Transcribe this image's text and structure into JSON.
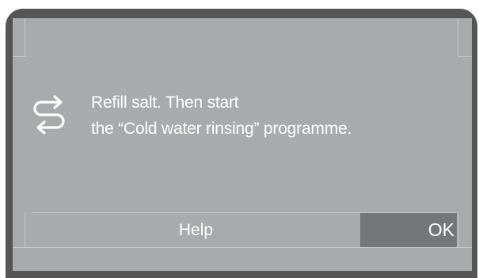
{
  "dialog": {
    "icon": "refill-arrows-icon",
    "message_line1": "Refill salt. Then start",
    "message_line2": "the “Cold water rinsing” programme."
  },
  "buttons": {
    "help_label": "Help",
    "ok_label": "OK"
  },
  "colors": {
    "bezel": "#555556",
    "screen": "#a9aaab",
    "ok_button": "#757677",
    "text": "#ffffff"
  }
}
